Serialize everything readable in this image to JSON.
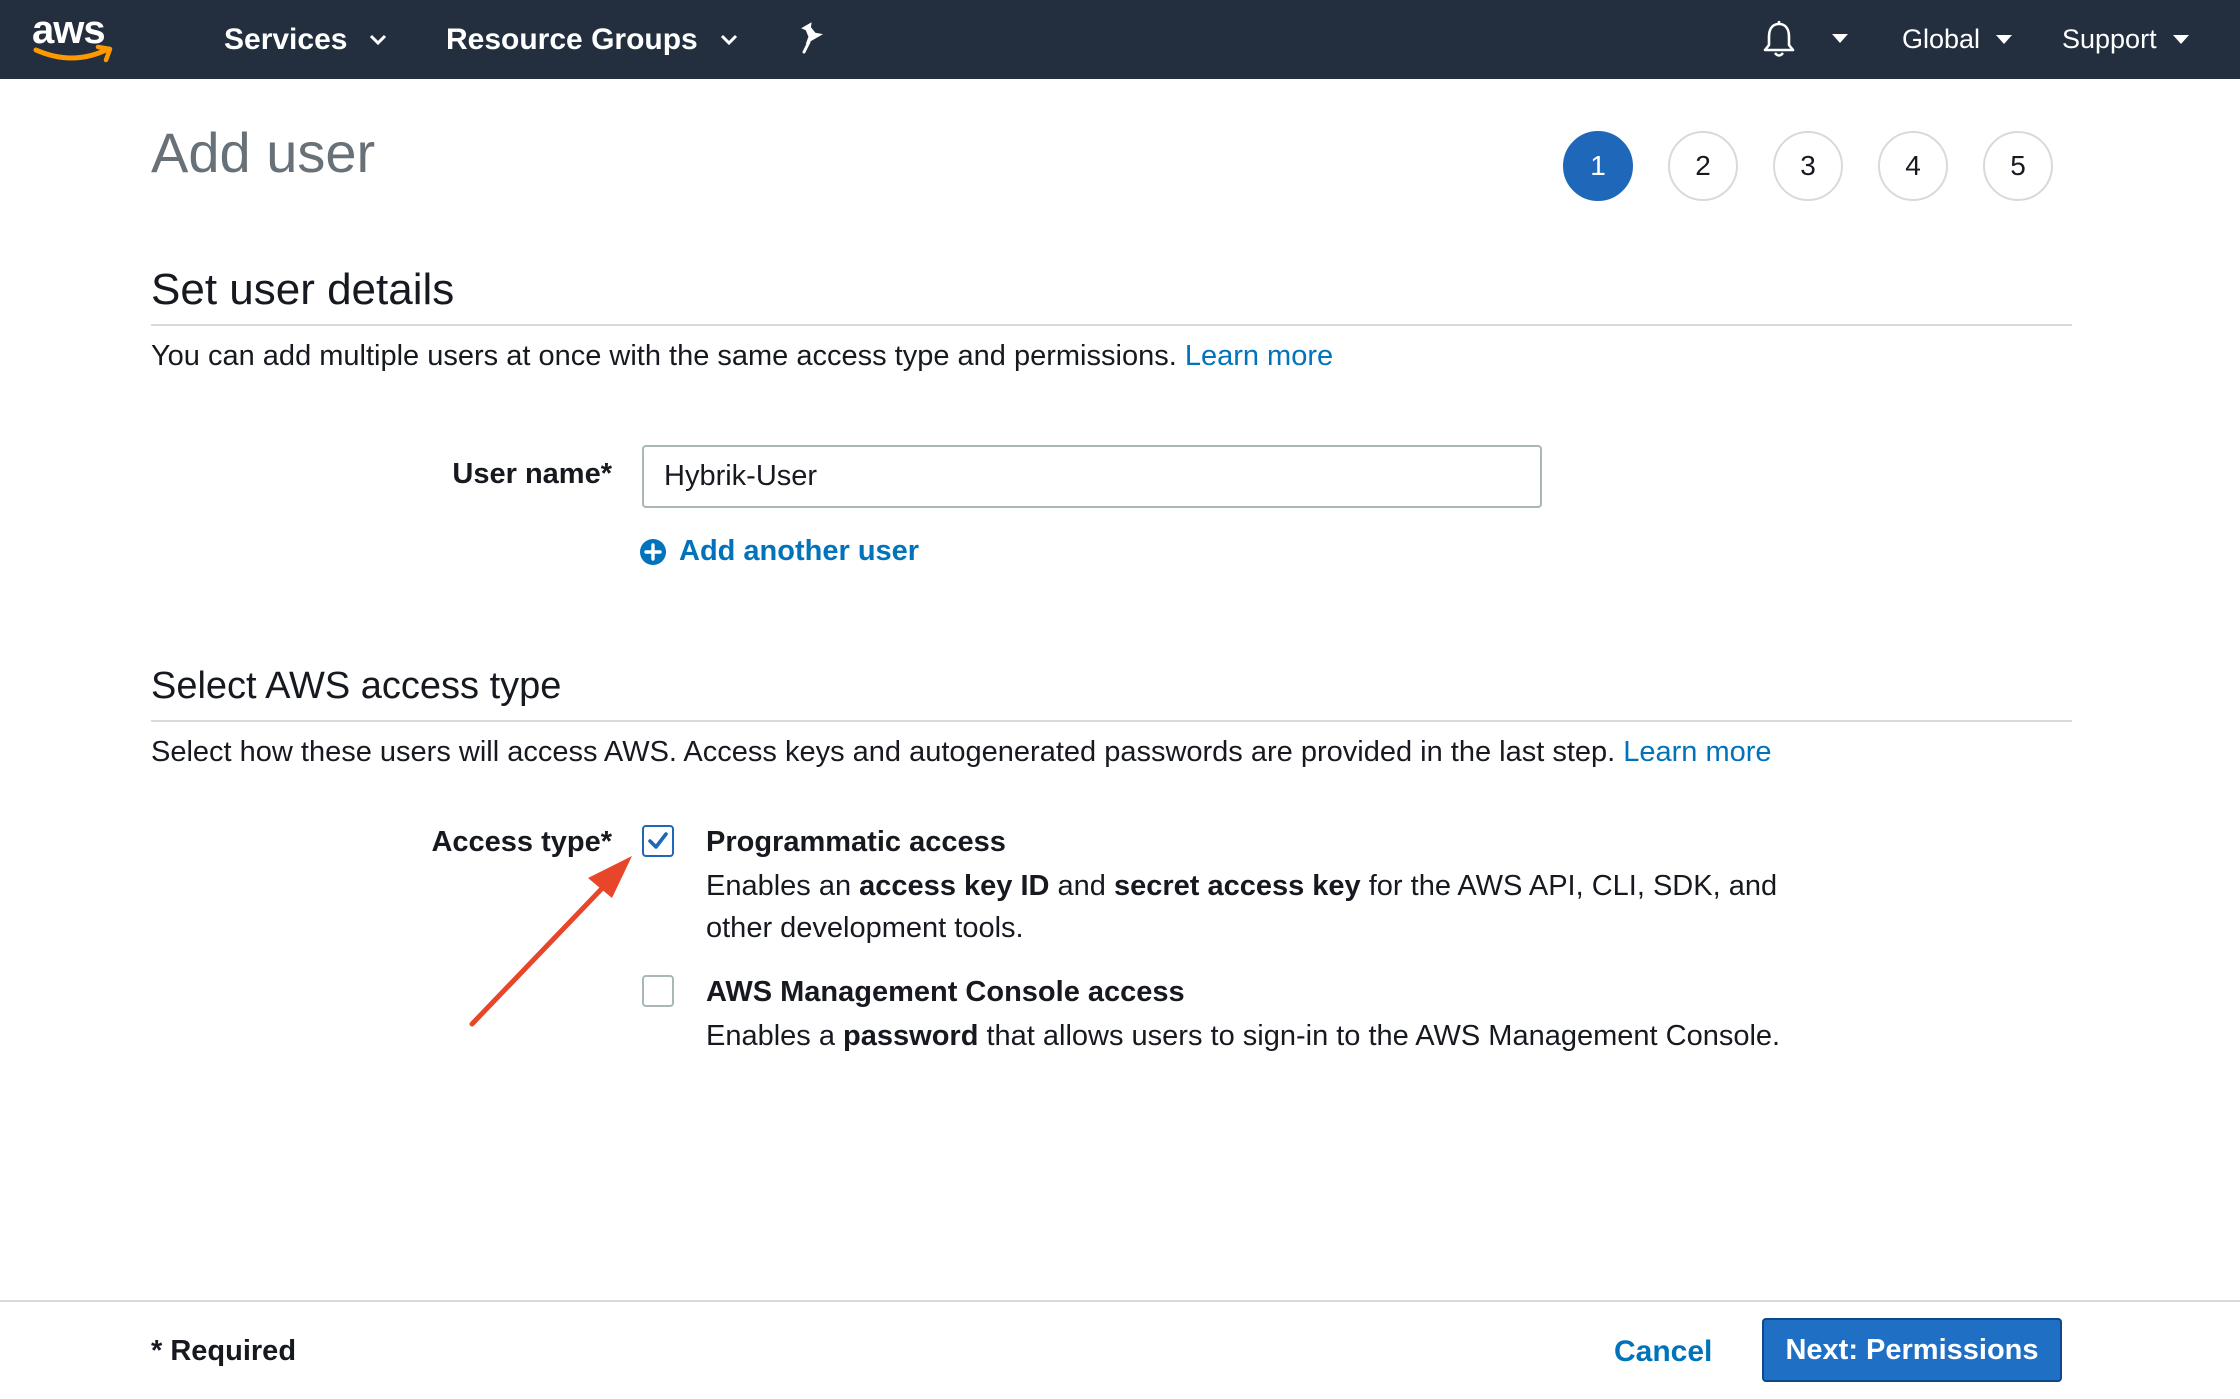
{
  "nav": {
    "logo_text": "aws",
    "services": "Services",
    "resource_groups": "Resource Groups",
    "region": "Global",
    "support": "Support"
  },
  "page": {
    "title": "Add user",
    "steps": [
      "1",
      "2",
      "3",
      "4",
      "5"
    ],
    "active_step": "1"
  },
  "details": {
    "heading": "Set user details",
    "description": "You can add multiple users at once with the same access type and permissions.",
    "learn_more": "Learn more",
    "user_name_label": "User name*",
    "user_name_value": "Hybrik-User",
    "add_another": "Add another user"
  },
  "access": {
    "heading": "Select AWS access type",
    "description": "Select how these users will access AWS. Access keys and autogenerated passwords are provided in the last step.",
    "learn_more": "Learn more",
    "label": "Access type*",
    "programmatic": {
      "title": "Programmatic access",
      "checked": true,
      "desc_1": "Enables an ",
      "desc_b1": "access key ID",
      "desc_2": " and ",
      "desc_b2": "secret access key",
      "desc_3": " for the AWS API, CLI, SDK, and other development tools."
    },
    "console": {
      "title": "AWS Management Console access",
      "checked": false,
      "desc_1": "Enables a ",
      "desc_b1": "password",
      "desc_2": " that allows users to sign-in to the AWS Management Console."
    }
  },
  "footer": {
    "required": "* Required",
    "cancel": "Cancel",
    "next": "Next: Permissions"
  },
  "colors": {
    "nav_bg": "#232f3e",
    "accent": "#1f68b9",
    "link": "#0073bb",
    "annotation_arrow": "#e8462a"
  }
}
